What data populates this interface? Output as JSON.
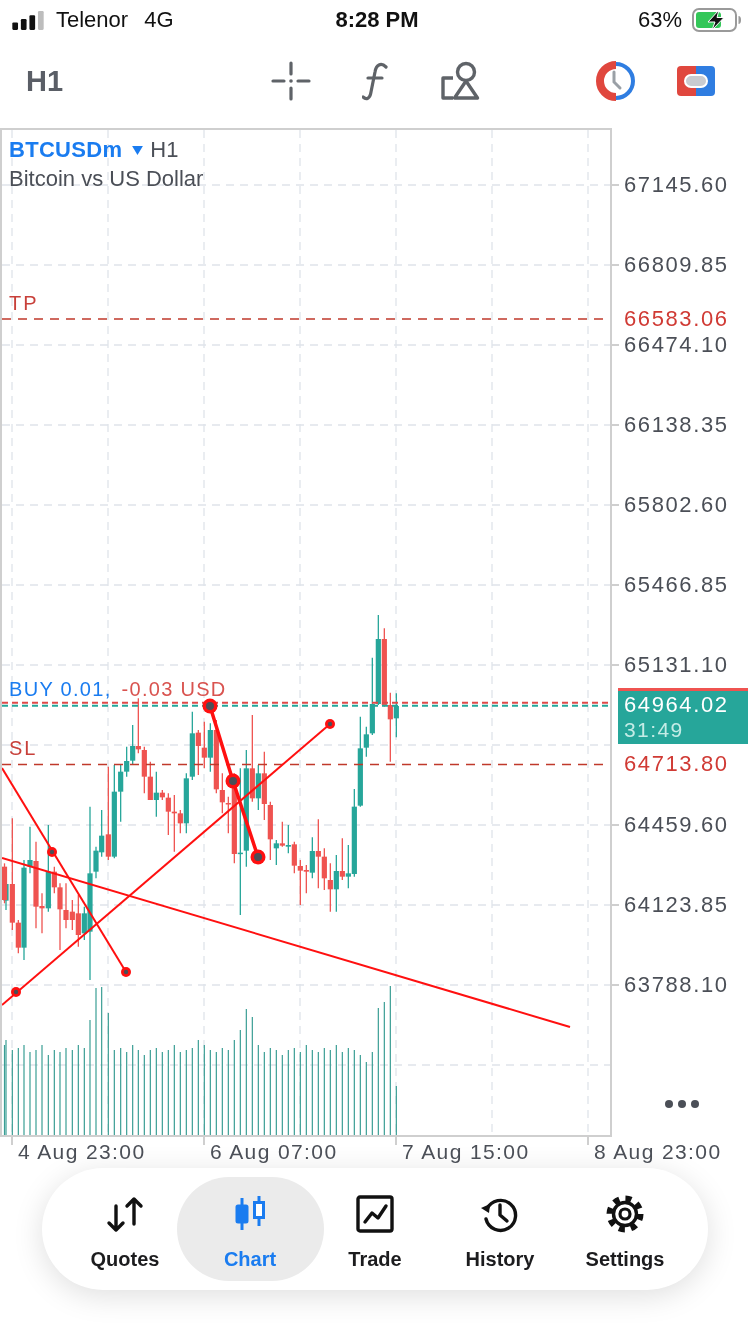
{
  "status_bar": {
    "carrier": "Telenor",
    "network": "4G",
    "time": "8:28 PM",
    "battery": "63%",
    "charging": true
  },
  "toolbar": {
    "timeframe": "H1"
  },
  "chart": {
    "symbol": "BTCUSDm",
    "timeframe": "H1",
    "description": "Bitcoin vs US Dollar",
    "price_axis": [
      "67145.60",
      "66809.85",
      "66474.10",
      "66138.35",
      "65802.60",
      "65466.85",
      "65131.10",
      "64459.60",
      "64123.85",
      "63788.10"
    ],
    "time_axis": [
      "4 Aug 23:00",
      "6 Aug 07:00",
      "7 Aug 15:00",
      "8 Aug 23:00"
    ],
    "levels": [
      {
        "label": "TP",
        "price": "66583.06"
      },
      {
        "label": "SL",
        "price": "64713.80"
      }
    ],
    "position": {
      "side": "BUY 0.01,",
      "profit": "-0.03 USD"
    },
    "current_price": {
      "price": "64964.02",
      "countdown": "31:49"
    }
  },
  "nav": [
    {
      "label": "Quotes",
      "selected": false
    },
    {
      "label": "Chart",
      "selected": true
    },
    {
      "label": "Trade",
      "selected": false
    },
    {
      "label": "History",
      "selected": false
    },
    {
      "label": "Settings",
      "selected": false
    }
  ]
}
